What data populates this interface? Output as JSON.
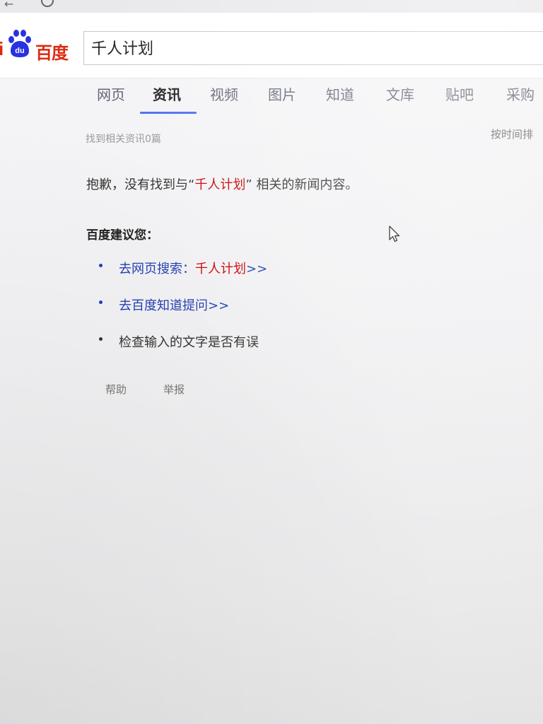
{
  "browser": {
    "back_icon": "arrow-left-icon",
    "reload_icon": "reload-icon"
  },
  "header": {
    "logo": {
      "icon": "baidu-paw-logo-icon",
      "text_i": "i",
      "text_cn": "百度",
      "paw_text": "du"
    },
    "search": {
      "value": "千人计划",
      "placeholder": ""
    },
    "colors": {
      "brand_red": "#de2910",
      "tab_underline": "#4e6ef2",
      "link_blue": "#2440b3"
    }
  },
  "tabs": [
    {
      "label": "网页",
      "active": false
    },
    {
      "label": "资讯",
      "active": true
    },
    {
      "label": "视频",
      "active": false
    },
    {
      "label": "图片",
      "active": false
    },
    {
      "label": "知道",
      "active": false
    },
    {
      "label": "文库",
      "active": false
    },
    {
      "label": "贴吧",
      "active": false
    },
    {
      "label": "采购",
      "active": false
    }
  ],
  "info": {
    "result_count": "找到相关资讯0篇",
    "sort_by": "按时间排"
  },
  "no_result": {
    "prefix": "抱歉，没有找到与“",
    "keyword": "千人计划",
    "suffix": "” 相关的新闻内容。"
  },
  "suggestions": {
    "title": "百度建议您：",
    "items": [
      {
        "prefix": "去网页搜索：",
        "keyword": "千人计划",
        "suffix": ">>"
      },
      {
        "text": "去百度知道提问>>"
      },
      {
        "text": "检查输入的文字是否有误"
      }
    ]
  },
  "footer": {
    "help": "帮助",
    "report": "举报"
  }
}
